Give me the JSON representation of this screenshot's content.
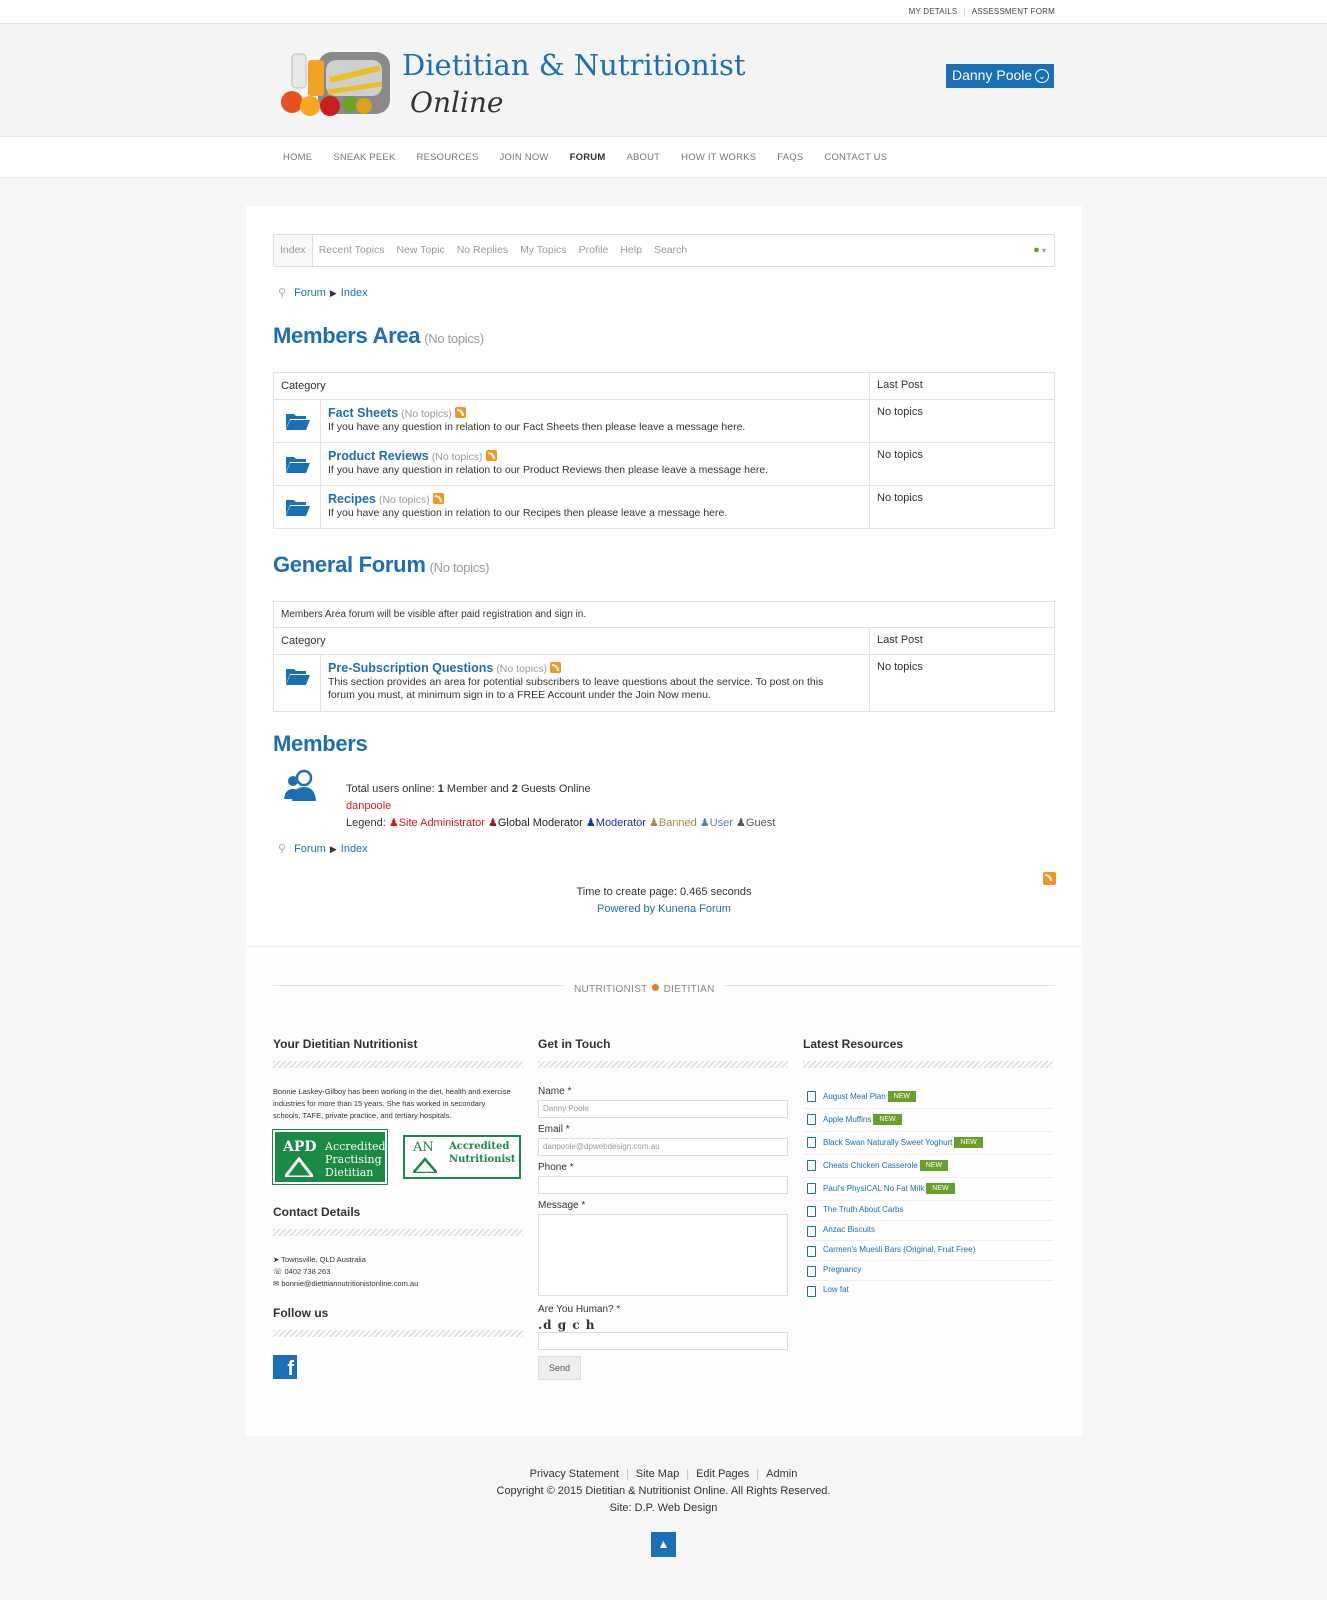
{
  "top": {
    "my_details": "MY DETAILS",
    "assessment_form": "ASSESSMENT FORM"
  },
  "logo": {
    "title": "Dietitian & Nutritionist",
    "subtitle": "Online"
  },
  "user": {
    "name": "Danny Poole"
  },
  "nav": [
    "HOME",
    "SNEAK PEEK",
    "RESOURCES",
    "JOIN NOW",
    "FORUM",
    "ABOUT",
    "HOW IT WORKS",
    "FAQS",
    "CONTACT US"
  ],
  "forum_tabs": [
    "Index",
    "Recent Topics",
    "New Topic",
    "No Replies",
    "My Topics",
    "Profile",
    "Help",
    "Search"
  ],
  "breadcrumb": {
    "forum": "Forum",
    "index": "Index"
  },
  "members_area": {
    "title": "Members Area",
    "count": "(No topics)",
    "col_category": "Category",
    "col_last": "Last Post",
    "categories": [
      {
        "name": "Fact Sheets",
        "count": "(No topics)",
        "desc": "If you have any question in relation to our Fact Sheets then please leave a message here.",
        "last": "No topics"
      },
      {
        "name": "Product Reviews",
        "count": "(No topics)",
        "desc": "If you have any question in relation to our Product Reviews then please leave a message here.",
        "last": "No topics"
      },
      {
        "name": "Recipes",
        "count": "(No topics)",
        "desc": "If you have any question in relation to our Recipes then please leave a message here.",
        "last": "No topics"
      }
    ]
  },
  "general_forum": {
    "title": "General Forum",
    "count": "(No topics)",
    "notice": "Members Area forum will be visible after paid registration and sign in.",
    "col_category": "Category",
    "col_last": "Last Post",
    "categories": [
      {
        "name": "Pre-Subscription Questions",
        "count": "(No topics)",
        "desc": "This section provides an area for potential subscribers to leave questions about the service. To post on this forum you must, at minimum sign in to a FREE Account under the Join Now menu.",
        "last": "No topics"
      }
    ]
  },
  "members": {
    "title": "Members",
    "online_label": "Total users online:",
    "member_count": "1",
    "member_word": "Member and",
    "guest_count": "2",
    "guest_word": "Guests Online",
    "online_user": "danpoole",
    "legend_label": "Legend:",
    "legend": {
      "site_admin": "Site Administrator",
      "global_mod": "Global Moderator",
      "moderator": "Moderator",
      "banned": "Banned",
      "user": "User",
      "guest": "Guest"
    }
  },
  "page_stats": {
    "time": "Time to create page: 0.465 seconds",
    "powered": "Powered by Kunena Forum"
  },
  "footer": {
    "divider_left": "NUTRITIONIST",
    "divider_right": "DIETITIAN",
    "about": {
      "title": "Your Dietitian Nutritionist",
      "text": "Bonnie Laskey-Gilboy has been working in the diet, health and exercise industries for more than 15 years. She has worked in secondary schools, TAFE, private practice, and tertiary hospitals.",
      "apd_abbr": "APD",
      "apd_line1": "Accredited",
      "apd_line2": "Practising",
      "apd_line3": "Dietitian",
      "an_abbr": "AN",
      "an_line1": "Accredited",
      "an_line2": "Nutritionist"
    },
    "contact": {
      "title": "Contact Details",
      "location": "Townsville, QLD Australia",
      "phone": "0402 738 263",
      "email": "bonnie@dietitiannutritionistonline.com.au"
    },
    "follow": {
      "title": "Follow us"
    },
    "get_in_touch": {
      "title": "Get in Touch",
      "name_label": "Name *",
      "name_value": "Danny Poole",
      "email_label": "Email *",
      "email_value": "danpoole@dpwebdesign.com.au",
      "phone_label": "Phone *",
      "message_label": "Message *",
      "human_label": "Are You Human? *",
      "captcha": ".d g c h",
      "send": "Send"
    },
    "latest": {
      "title": "Latest Resources",
      "new_label": "NEW",
      "items": [
        {
          "name": "August Meal Plan",
          "new": true
        },
        {
          "name": "Apple Muffins",
          "new": true
        },
        {
          "name": "Black Swan Naturally Sweet Yoghurt",
          "new": true
        },
        {
          "name": "Cheats Chicken Casserole",
          "new": true
        },
        {
          "name": "Paul's PhysiCAL No Fat Milk",
          "new": true
        },
        {
          "name": "The Truth About Carbs",
          "new": false
        },
        {
          "name": "Anzac Biscuits",
          "new": false
        },
        {
          "name": "Carmen's Muesli Bars (Original, Fruit Free)",
          "new": false
        },
        {
          "name": "Pregnancy",
          "new": false
        },
        {
          "name": "Low fat",
          "new": false
        }
      ]
    }
  },
  "bottom": {
    "links": [
      "Privacy Statement",
      "Site Map",
      "Edit Pages",
      "Admin"
    ],
    "copyright": "Copyright © 2015 Dietitian & Nutritionist Online. All Rights Reserved.",
    "site": "Site: D.P. Web Design"
  },
  "colors": {
    "brand_blue": "#1a6fb5",
    "rss_orange": "#f7931e",
    "new_green": "#6a9f2c",
    "accredited_green": "#1a8a44"
  }
}
